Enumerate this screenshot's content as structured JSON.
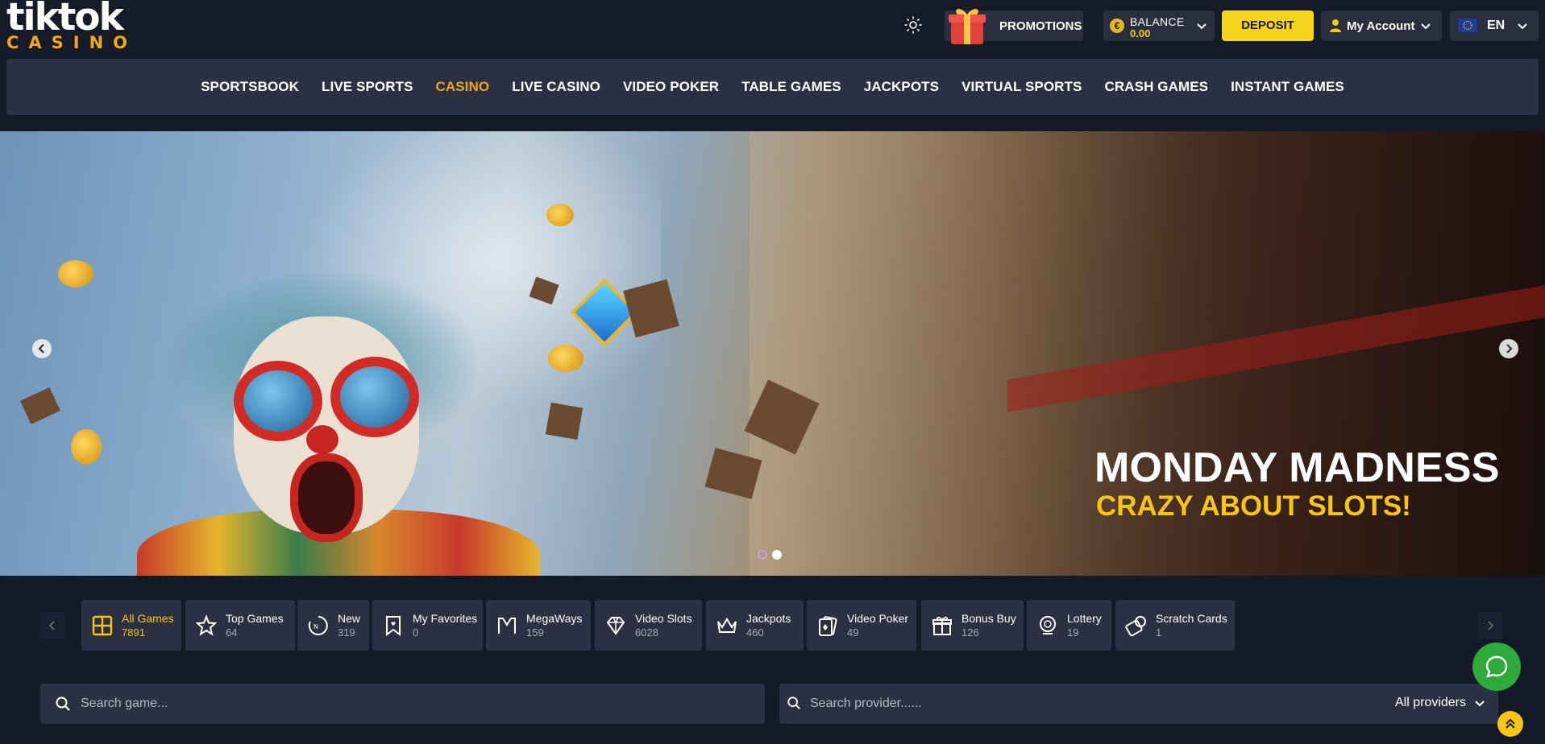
{
  "brand": {
    "logo_top": "tiktok",
    "logo_bottom": "CASINO",
    "accent": "#f2a61e"
  },
  "header": {
    "promotions_label": "PROMOTIONS",
    "balance_label": "BALANCE",
    "balance_value": "0.00",
    "currency_symbol": "€",
    "deposit_label": "DEPOSIT",
    "account_label": "My Account",
    "language_label": "EN"
  },
  "nav": {
    "items": [
      {
        "label": "SPORTSBOOK"
      },
      {
        "label": "LIVE SPORTS"
      },
      {
        "label": "CASINO",
        "active": true
      },
      {
        "label": "LIVE CASINO"
      },
      {
        "label": "VIDEO POKER"
      },
      {
        "label": "TABLE GAMES"
      },
      {
        "label": "JACKPOTS"
      },
      {
        "label": "VIRTUAL SPORTS"
      },
      {
        "label": "CRASH GAMES"
      },
      {
        "label": "INSTANT GAMES"
      }
    ]
  },
  "hero": {
    "title": "MONDAY MADNESS",
    "subtitle": "CRAZY ABOUT SLOTS!",
    "slide_count": 2,
    "active_slide": 2
  },
  "categories": [
    {
      "label": "All Games",
      "count": "7891",
      "icon": "grid-icon",
      "active": true
    },
    {
      "label": "Top Games",
      "count": "64",
      "icon": "star-icon"
    },
    {
      "label": "New",
      "count": "319",
      "icon": "new-badge-icon"
    },
    {
      "label": "My Favorites",
      "count": "0",
      "icon": "favorite-ribbon-icon"
    },
    {
      "label": "MegaWays",
      "count": "159",
      "icon": "megaways-icon"
    },
    {
      "label": "Video Slots",
      "count": "6028",
      "icon": "diamond-icon"
    },
    {
      "label": "Jackpots",
      "count": "460",
      "icon": "crown-icon"
    },
    {
      "label": "Video Poker",
      "count": "49",
      "icon": "cards-icon"
    },
    {
      "label": "Bonus Buy",
      "count": "126",
      "icon": "gift-icon"
    },
    {
      "label": "Lottery",
      "count": "19",
      "icon": "lottery-ball-icon"
    },
    {
      "label": "Scratch Cards",
      "count": "1",
      "icon": "scratch-card-icon"
    }
  ],
  "search": {
    "game_placeholder": "Search game...",
    "provider_placeholder": "Search provider......",
    "provider_select": "All providers"
  },
  "colors": {
    "background": "#151a29",
    "panel": "#2b3042",
    "deposit": "#f6d41b",
    "chat": "#2eaa3b",
    "highlight": "#f6c516"
  }
}
